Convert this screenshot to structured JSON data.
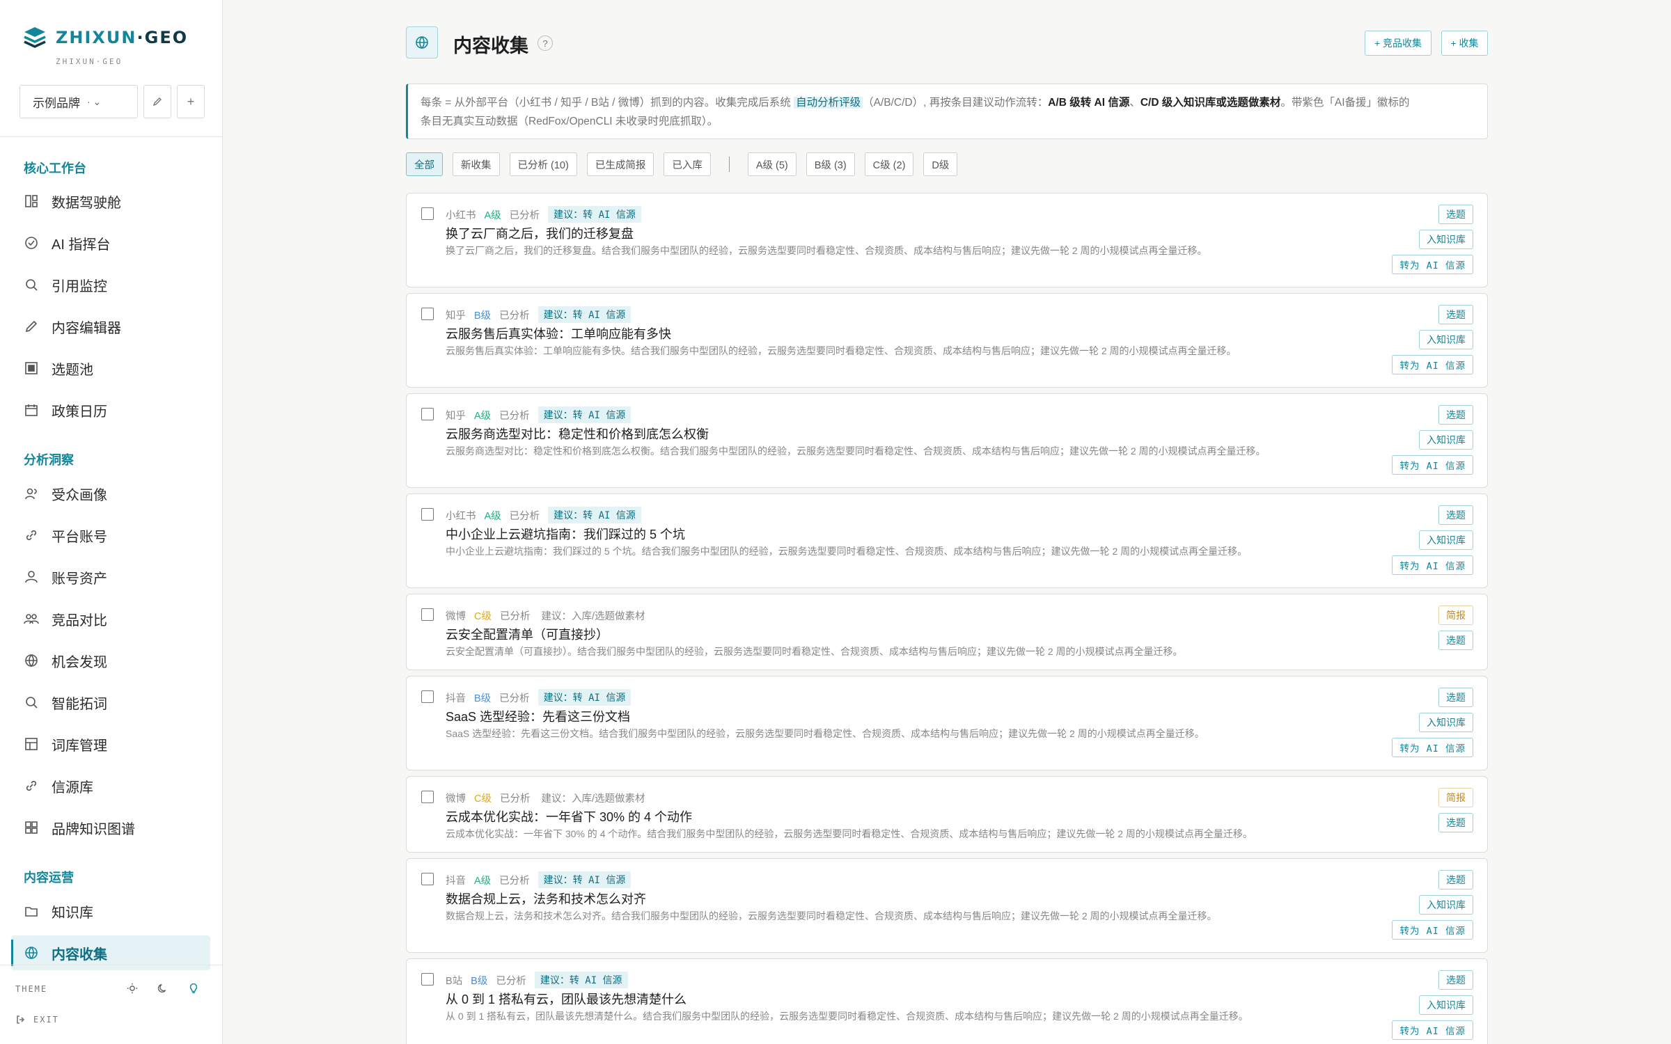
{
  "brand": {
    "name_a": "ZHIXUN",
    "name_dot": "·",
    "name_b": "GEO",
    "sub": "ZHIXUN·GEO"
  },
  "brand_select": {
    "value": "示例品牌",
    "caret": "·  ⌄"
  },
  "sidebar": {
    "sections": [
      "核心工作台",
      "分析洞察",
      "内容运营"
    ],
    "core": [
      {
        "label": "数据驾驶舱",
        "icon": "dashboard-icon"
      },
      {
        "label": "AI 指挥台",
        "icon": "check-circle-icon"
      },
      {
        "label": "引用监控",
        "icon": "search-icon"
      },
      {
        "label": "内容编辑器",
        "icon": "pencil-icon"
      },
      {
        "label": "选题池",
        "icon": "square-stack-icon"
      },
      {
        "label": "政策日历",
        "icon": "calendar-icon"
      }
    ],
    "insight": [
      {
        "label": "受众画像",
        "icon": "users-icon"
      },
      {
        "label": "平台账号",
        "icon": "link-icon"
      },
      {
        "label": "账号资产",
        "icon": "user-icon"
      },
      {
        "label": "竞品对比",
        "icon": "group-icon"
      },
      {
        "label": "机会发现",
        "icon": "globe-icon"
      },
      {
        "label": "智能拓词",
        "icon": "search-icon"
      },
      {
        "label": "词库管理",
        "icon": "table-icon"
      },
      {
        "label": "信源库",
        "icon": "link-icon"
      },
      {
        "label": "品牌知识图谱",
        "icon": "grid-icon"
      }
    ],
    "ops": [
      {
        "label": "知识库",
        "icon": "folder-icon"
      },
      {
        "label": "内容收集",
        "icon": "globe-icon",
        "active": true
      }
    ],
    "theme_label": "THEME",
    "exit_label": "EXIT"
  },
  "header": {
    "title": "内容收集",
    "help": "?",
    "btn_competitor": "+ 竞品收集",
    "btn_collect": "+ 收集"
  },
  "info": {
    "p1": "每条 = 从外部平台（小红书 / 知乎 / B站 / 微博）抓到的内容。收集完成后系统 ",
    "hl": "自动分析评级",
    "p2": "（A/B/C/D）, 再按条目建议动作流转：",
    "b1": "A/B 级转 AI 信源",
    "p3": "、",
    "b2": "C/D 级入知识库或选题做素材",
    "p4": "。带紫色「AI备援」徽标的",
    "p5": "条目无真实互动数据（RedFox/OpenCLI 未收录时兜底抓取）。"
  },
  "filters": [
    "全部",
    "新收集",
    "已分析 (10)",
    "已生成简报",
    "已入库"
  ],
  "grade_filters": [
    "A级 (5)",
    "B级 (3)",
    "C级 (2)",
    "D级"
  ],
  "items": [
    {
      "platform": "小红书",
      "grade": "A级",
      "g": "A",
      "status": "已分析",
      "suggestion": "建议：转 AI 信源",
      "hl": true,
      "title": "换了云厂商之后，我们的迁移复盘",
      "desc": "换了云厂商之后，我们的迁移复盘。结合我们服务中型团队的经验，云服务选型要同时看稳定性、合规资质、成本结构与售后响应；建议先做一轮 2 周的小规模试点再全量迁移。",
      "actions": [
        "选题",
        "入知识库",
        "转为 AI 信源"
      ]
    },
    {
      "platform": "知乎",
      "grade": "B级",
      "g": "B",
      "status": "已分析",
      "suggestion": "建议：转 AI 信源",
      "hl": true,
      "title": "云服务售后真实体验：工单响应能有多快",
      "desc": "云服务售后真实体验：工单响应能有多快。结合我们服务中型团队的经验，云服务选型要同时看稳定性、合规资质、成本结构与售后响应；建议先做一轮 2 周的小规模试点再全量迁移。",
      "actions": [
        "选题",
        "入知识库",
        "转为 AI 信源"
      ]
    },
    {
      "platform": "知乎",
      "grade": "A级",
      "g": "A",
      "status": "已分析",
      "suggestion": "建议：转 AI 信源",
      "hl": true,
      "title": "云服务商选型对比：稳定性和价格到底怎么权衡",
      "desc": "云服务商选型对比：稳定性和价格到底怎么权衡。结合我们服务中型团队的经验，云服务选型要同时看稳定性、合规资质、成本结构与售后响应；建议先做一轮 2 周的小规模试点再全量迁移。",
      "actions": [
        "选题",
        "入知识库",
        "转为 AI 信源"
      ]
    },
    {
      "platform": "小红书",
      "grade": "A级",
      "g": "A",
      "status": "已分析",
      "suggestion": "建议：转 AI 信源",
      "hl": true,
      "title": "中小企业上云避坑指南：我们踩过的 5 个坑",
      "desc": "中小企业上云避坑指南：我们踩过的 5 个坑。结合我们服务中型团队的经验，云服务选型要同时看稳定性、合规资质、成本结构与售后响应；建议先做一轮 2 周的小规模试点再全量迁移。",
      "actions": [
        "选题",
        "入知识库",
        "转为 AI 信源"
      ]
    },
    {
      "platform": "微博",
      "grade": "C级",
      "g": "C",
      "status": "已分析",
      "suggestion": "建议：入库/选题做素材",
      "hl": false,
      "title": "云安全配置清单（可直接抄）",
      "desc": "云安全配置清单（可直接抄）。结合我们服务中型团队的经验，云服务选型要同时看稳定性、合规资质、成本结构与售后响应；建议先做一轮 2 周的小规模试点再全量迁移。",
      "actions": [
        "简报",
        "选题"
      ]
    },
    {
      "platform": "抖音",
      "grade": "B级",
      "g": "B",
      "status": "已分析",
      "suggestion": "建议：转 AI 信源",
      "hl": true,
      "title": "SaaS 选型经验：先看这三份文档",
      "desc": "SaaS 选型经验：先看这三份文档。结合我们服务中型团队的经验，云服务选型要同时看稳定性、合规资质、成本结构与售后响应；建议先做一轮 2 周的小规模试点再全量迁移。",
      "actions": [
        "选题",
        "入知识库",
        "转为 AI 信源"
      ]
    },
    {
      "platform": "微博",
      "grade": "C级",
      "g": "C",
      "status": "已分析",
      "suggestion": "建议：入库/选题做素材",
      "hl": false,
      "title": "云成本优化实战：一年省下 30% 的 4 个动作",
      "desc": "云成本优化实战：一年省下 30% 的 4 个动作。结合我们服务中型团队的经验，云服务选型要同时看稳定性、合规资质、成本结构与售后响应；建议先做一轮 2 周的小规模试点再全量迁移。",
      "actions": [
        "简报",
        "选题"
      ]
    },
    {
      "platform": "抖音",
      "grade": "A级",
      "g": "A",
      "status": "已分析",
      "suggestion": "建议：转 AI 信源",
      "hl": true,
      "title": "数据合规上云，法务和技术怎么对齐",
      "desc": "数据合规上云，法务和技术怎么对齐。结合我们服务中型团队的经验，云服务选型要同时看稳定性、合规资质、成本结构与售后响应；建议先做一轮 2 周的小规模试点再全量迁移。",
      "actions": [
        "选题",
        "入知识库",
        "转为 AI 信源"
      ]
    },
    {
      "platform": "B站",
      "grade": "B级",
      "g": "B",
      "status": "已分析",
      "suggestion": "建议：转 AI 信源",
      "hl": true,
      "title": "从 0 到 1 搭私有云，团队最该先想清楚什么",
      "desc": "从 0 到 1 搭私有云，团队最该先想清楚什么。结合我们服务中型团队的经验，云服务选型要同时看稳定性、合规资质、成本结构与售后响应；建议先做一轮 2 周的小规模试点再全量迁移。",
      "actions": [
        "选题",
        "入知识库",
        "转为 AI 信源"
      ]
    }
  ],
  "colors": {
    "accent": "#12869b",
    "grade_a": "#22b07d",
    "grade_b": "#4a8fd4",
    "grade_c": "#e0a81b"
  }
}
